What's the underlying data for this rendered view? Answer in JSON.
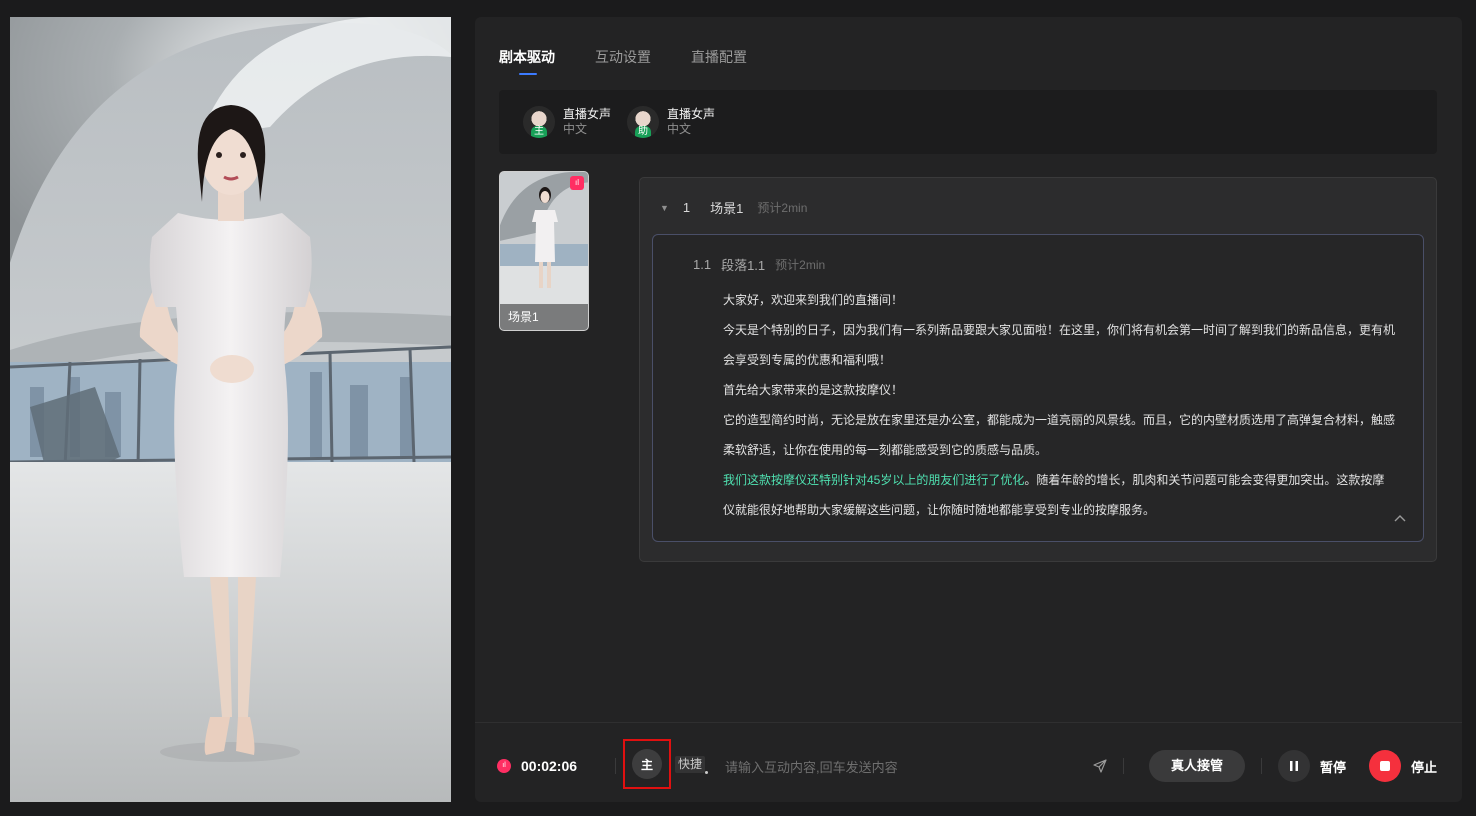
{
  "tabs": [
    {
      "label": "剧本驱动",
      "active": true
    },
    {
      "label": "互动设置",
      "active": false
    },
    {
      "label": "直播配置",
      "active": false
    }
  ],
  "voices": [
    {
      "role": "主",
      "name": "直播女声",
      "lang": "中文"
    },
    {
      "role": "助",
      "name": "直播女声",
      "lang": "中文"
    }
  ],
  "scene_thumb": {
    "label": "场景1",
    "live_icon": "audio-wave-icon"
  },
  "scene": {
    "num": "1",
    "title": "场景1",
    "estimate": "预计2min"
  },
  "paragraph": {
    "num": "1.1",
    "title": "段落1.1",
    "estimate": "预计2min",
    "lines": [
      "大家好，欢迎来到我们的直播间！",
      "今天是个特别的日子，因为我们有一系列新品要跟大家见面啦！在这里，你们将有机会第一时间了解到我们的新品信息，更有机",
      "会享受到专属的优惠和福利哦！",
      "首先给大家带来的是这款按摩仪！",
      "它的造型简约时尚，无论是放在家里还是办公室，都能成为一道亮丽的风景线。而且，它的内壁材质选用了高弹复合材料，触感",
      "柔软舒适，让你在使用的每一刻都能感受到它的质感与品质。"
    ],
    "highlight": "我们这款按摩仪还特别针对45岁以上的朋友们进行了优化",
    "after_highlight": "。随着年龄的增长，肌肉和关节问题可能会变得更加突出。这款按摩",
    "last_line": "仪就能很好地帮助大家缓解这些问题，让你随时随地都能享受到专业的按摩服务。"
  },
  "bottom": {
    "timer": "00:02:06",
    "role_button": "主",
    "quick_label": "快捷",
    "input_placeholder": "请输入互动内容,回车发送内容",
    "takeover_label": "真人接管",
    "pause_label": "暂停",
    "stop_label": "停止"
  },
  "colors": {
    "accent": "#3c7bff",
    "live": "#ff2e63",
    "stop": "#f5303d",
    "highlight": "#4fe0b0"
  }
}
